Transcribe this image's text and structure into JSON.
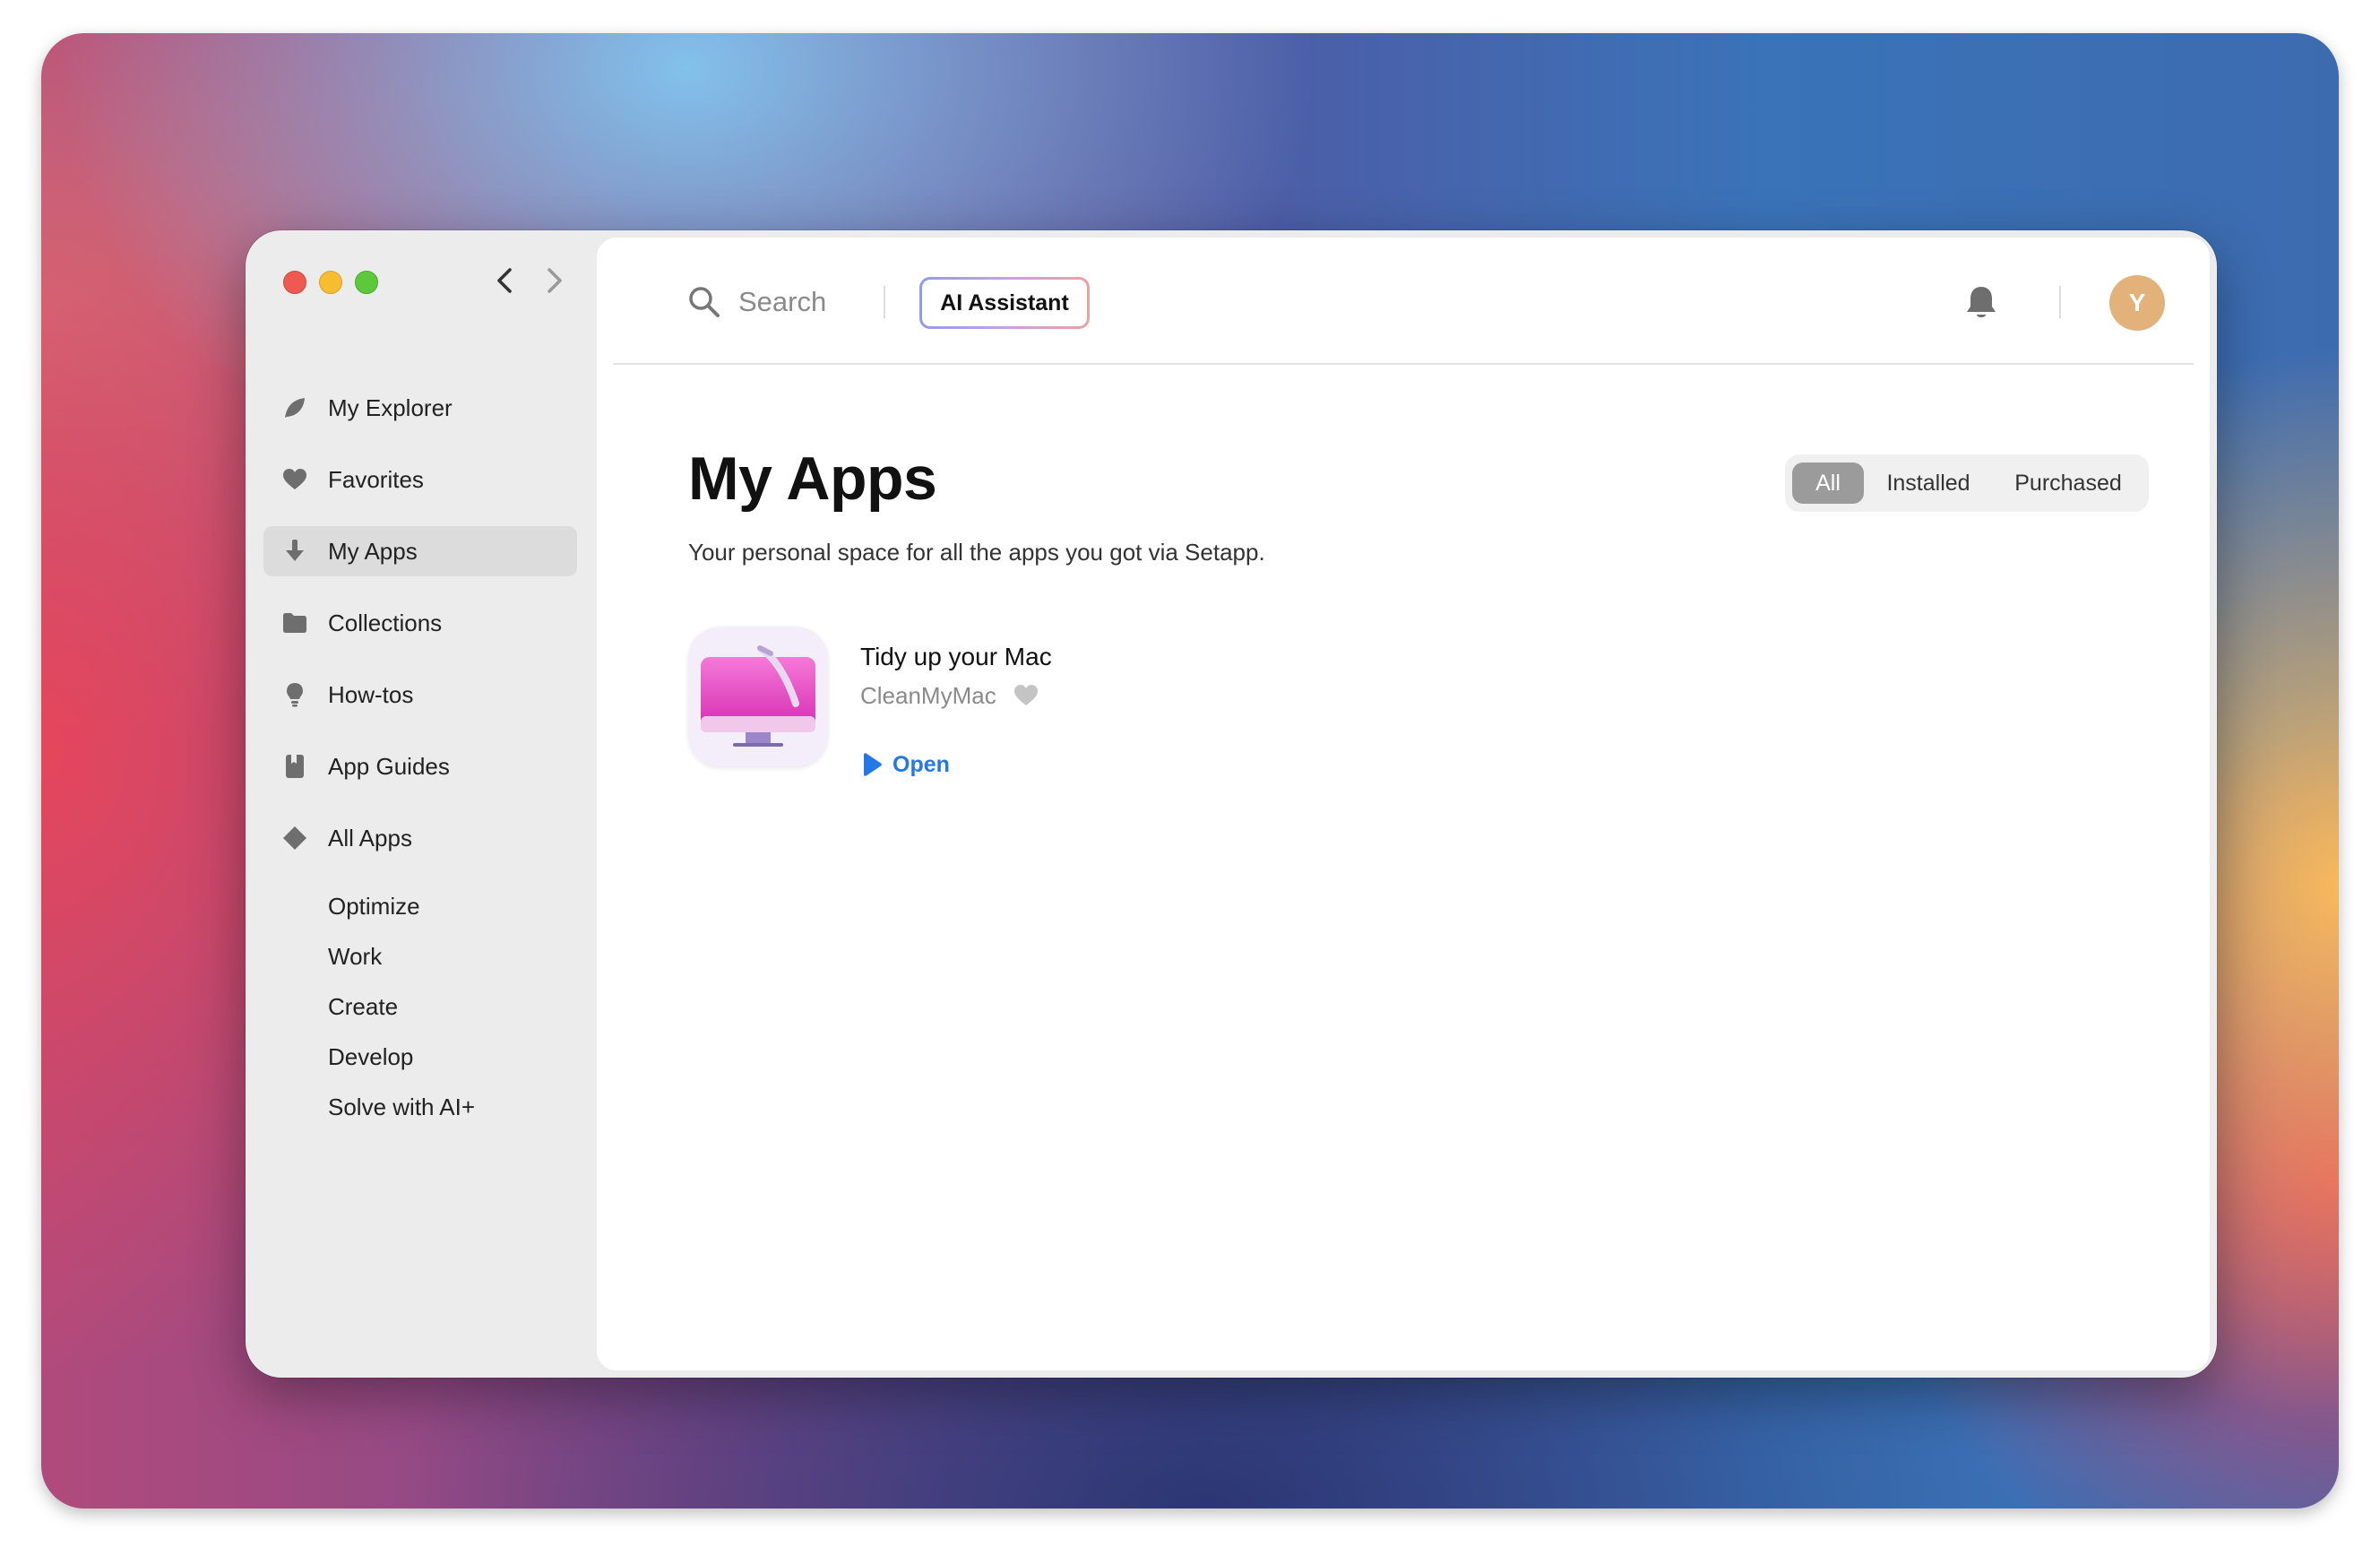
{
  "sidebar": {
    "nav": [
      {
        "label": "My Explorer",
        "icon": "leaf-icon"
      },
      {
        "label": "Favorites",
        "icon": "heart-icon"
      },
      {
        "label": "My Apps",
        "icon": "download-icon",
        "active": true
      },
      {
        "label": "Collections",
        "icon": "folder-icon"
      },
      {
        "label": "How-tos",
        "icon": "lightbulb-icon"
      },
      {
        "label": "App Guides",
        "icon": "book-icon"
      },
      {
        "label": "All Apps",
        "icon": "diamond-icon"
      }
    ],
    "categories": [
      "Optimize",
      "Work",
      "Create",
      "Develop",
      "Solve with AI+"
    ]
  },
  "header": {
    "search_placeholder": "Search",
    "ai_assistant_label": "AI Assistant",
    "avatar_initial": "Y"
  },
  "main": {
    "title": "My Apps",
    "subtitle": "Your personal space for all the apps you got via Setapp.",
    "filters": {
      "all": "All",
      "installed": "Installed",
      "purchased": "Purchased",
      "selected": "All"
    },
    "apps": [
      {
        "tagline": "Tidy up your Mac",
        "name": "CleanMyMac",
        "action": "Open"
      }
    ]
  },
  "colors": {
    "accent": "#2478e6",
    "avatar": "#e3b27a",
    "active_filter": "#9b9b9b",
    "app_icon_pink": "#e040c0"
  }
}
